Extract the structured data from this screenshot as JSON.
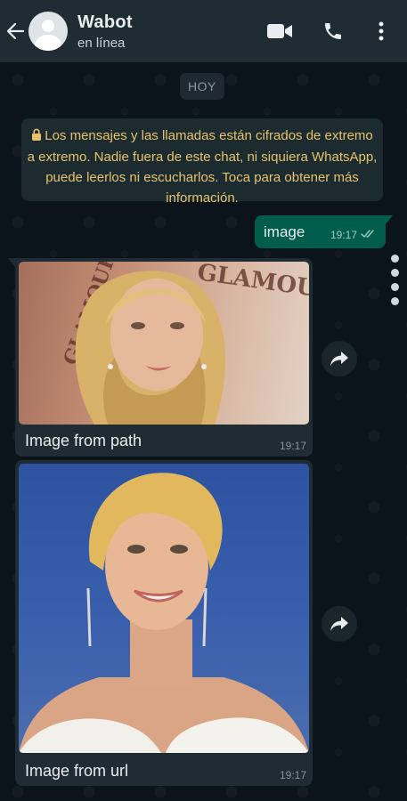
{
  "header": {
    "contact_name": "Wabot",
    "contact_status": "en línea",
    "icons": [
      "back-arrow-icon",
      "avatar",
      "video-call-icon",
      "phone-icon",
      "more-options-icon"
    ]
  },
  "chat": {
    "day_separator": "HOY",
    "encryption_notice": "Los mensajes y las llamadas están cifrados de extremo a extremo. Nadie fuera de este chat, ni siquiera WhatsApp, puede leerlos ni escucharlos. Toca para obtener más información.",
    "outgoing": {
      "text": "image",
      "time": "19:17",
      "status": "read-double-tick"
    },
    "incoming": [
      {
        "image": "photo-woman-blonde-wavy-hair-glamour-backdrop",
        "caption": "Image from path",
        "time": "19:17",
        "backdrop_text": "GLAMOUR"
      },
      {
        "image": "photo-woman-short-blonde-hair-blue-backdrop",
        "caption": "Image from url",
        "time": "19:17"
      }
    ]
  },
  "colors": {
    "header_bg": "#1f2c34",
    "chat_bg": "#0b141a",
    "outgoing_bubble": "#005c4b",
    "incoming_bubble": "#1f2c34",
    "system_text": "#e8c26a"
  }
}
